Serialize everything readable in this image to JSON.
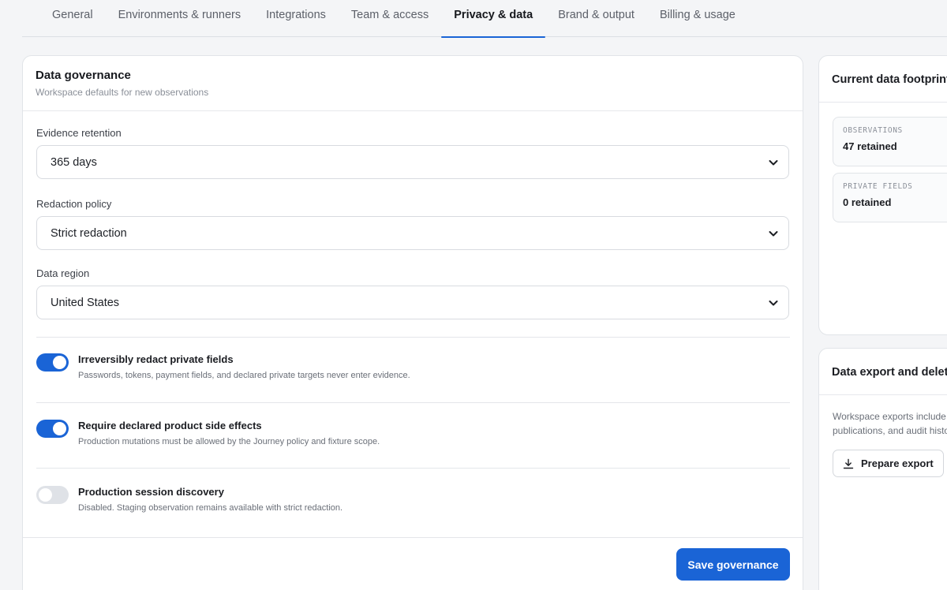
{
  "tabs": [
    {
      "label": "General",
      "active": false
    },
    {
      "label": "Environments & runners",
      "active": false
    },
    {
      "label": "Integrations",
      "active": false
    },
    {
      "label": "Team & access",
      "active": false
    },
    {
      "label": "Privacy & data",
      "active": true
    },
    {
      "label": "Brand & output",
      "active": false
    },
    {
      "label": "Billing & usage",
      "active": false
    }
  ],
  "governance": {
    "title": "Data governance",
    "subtitle": "Workspace defaults for new observations",
    "fields": [
      {
        "label": "Evidence retention",
        "value": "365 days"
      },
      {
        "label": "Redaction policy",
        "value": "Strict redaction"
      },
      {
        "label": "Data region",
        "value": "United States"
      }
    ],
    "toggles": [
      {
        "title": "Irreversibly redact private fields",
        "description": "Passwords, tokens, payment fields, and declared private targets never enter evidence.",
        "on": true
      },
      {
        "title": "Require declared product side effects",
        "description": "Production mutations must be allowed by the Journey policy and fixture scope.",
        "on": true
      },
      {
        "title": "Production session discovery",
        "description": "Disabled. Staging observation remains available with strict redaction.",
        "on": false
      }
    ],
    "save_label": "Save governance"
  },
  "footprint": {
    "title": "Current data footprint",
    "stats": [
      {
        "label": "OBSERVATIONS",
        "value": "47 retained"
      },
      {
        "label": "PRIVATE FIELDS",
        "value": "0 retained"
      }
    ]
  },
  "export": {
    "title": "Data export and deletion",
    "text_line1": "Workspace exports include",
    "text_line2": "publications, and audit history",
    "button_label": "Prepare export"
  },
  "colors": {
    "accent": "#1a64d6",
    "toggle_off": "#dfe2e7"
  }
}
